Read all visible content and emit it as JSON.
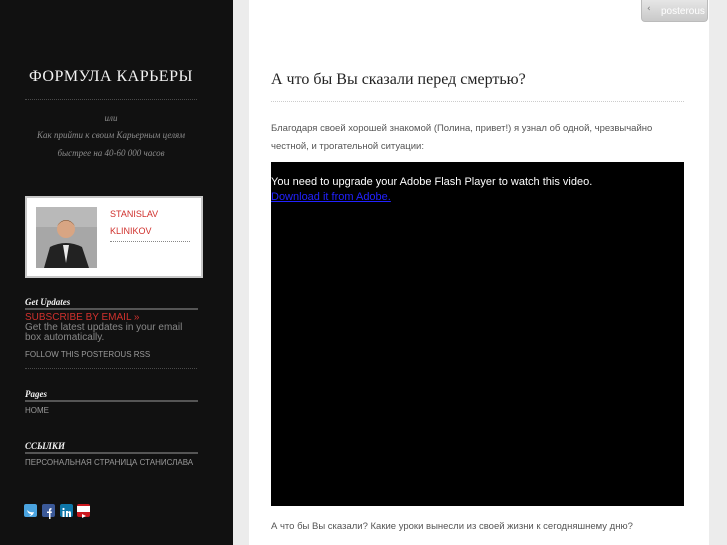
{
  "blog": {
    "title": "ФОРМУЛА КАРЬЕРЫ",
    "tagline_1": "или",
    "tagline_2": "Как прийти к своим Карьерным целям",
    "tagline_3": "быстрее на 40-60 000 часов"
  },
  "author": {
    "first_name": "STANISLAV",
    "last_name": "KLINIKOV"
  },
  "sidebar": {
    "updates_heading": "Get Updates",
    "subscribe_email": "SUBSCRIBE BY EMAIL »",
    "updates_description": "Get the latest updates in your email box automatically.",
    "rss": "FOLLOW THIS POSTEROUS RSS",
    "pages_heading": "Pages",
    "pages": [
      "HOME"
    ],
    "links_heading": "ССЫЛКИ",
    "links": [
      "ПЕРСОНАЛЬНАЯ СТРАНИЦА СТАНИСЛАВА"
    ],
    "social_icons": [
      "twitter-icon",
      "facebook-icon",
      "linkedin-icon",
      "youtube-icon"
    ]
  },
  "header": {
    "posterous_label": "posterous"
  },
  "post": {
    "title": "А что бы Вы сказали перед смертью?",
    "intro": "Благодаря своей хорошей знакомой (Полина, привет!) я узнал об одной, чрезвычайно честной, и трогательной ситуации:",
    "flash_message": "You need to upgrade your Adobe Flash Player to watch this video.",
    "flash_link": "Download it from Adobe.",
    "outro": "А что бы Вы сказали? Какие уроки вынесли из своей жизни к сегодняшнему дню?"
  },
  "colors": {
    "sidebar_bg": "#111111",
    "accent_red": "#d0312d",
    "twitter": "#4aa3df",
    "facebook": "#3b5998",
    "linkedin": "#0e76a8",
    "youtube": "#cc181e"
  }
}
